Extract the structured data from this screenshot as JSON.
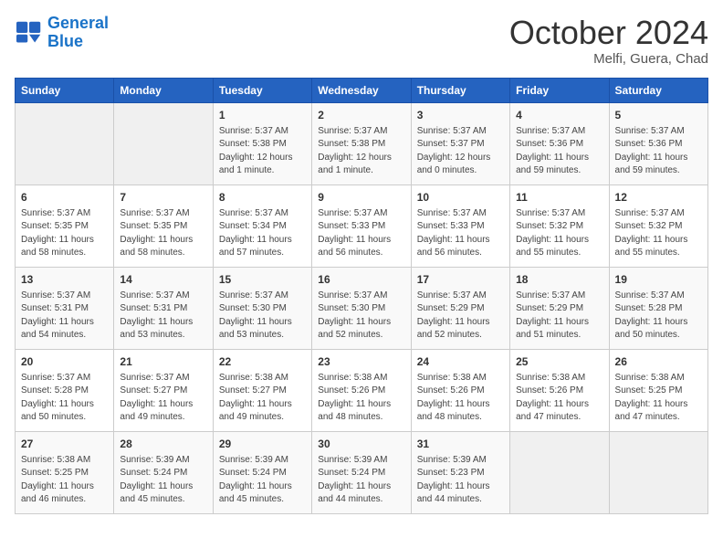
{
  "header": {
    "logo_line1": "General",
    "logo_line2": "Blue",
    "month": "October 2024",
    "location": "Melfi, Guera, Chad"
  },
  "weekdays": [
    "Sunday",
    "Monday",
    "Tuesday",
    "Wednesday",
    "Thursday",
    "Friday",
    "Saturday"
  ],
  "weeks": [
    [
      {
        "day": "",
        "info": ""
      },
      {
        "day": "",
        "info": ""
      },
      {
        "day": "1",
        "info": "Sunrise: 5:37 AM\nSunset: 5:38 PM\nDaylight: 12 hours and 1 minute."
      },
      {
        "day": "2",
        "info": "Sunrise: 5:37 AM\nSunset: 5:38 PM\nDaylight: 12 hours and 1 minute."
      },
      {
        "day": "3",
        "info": "Sunrise: 5:37 AM\nSunset: 5:37 PM\nDaylight: 12 hours and 0 minutes."
      },
      {
        "day": "4",
        "info": "Sunrise: 5:37 AM\nSunset: 5:36 PM\nDaylight: 11 hours and 59 minutes."
      },
      {
        "day": "5",
        "info": "Sunrise: 5:37 AM\nSunset: 5:36 PM\nDaylight: 11 hours and 59 minutes."
      }
    ],
    [
      {
        "day": "6",
        "info": "Sunrise: 5:37 AM\nSunset: 5:35 PM\nDaylight: 11 hours and 58 minutes."
      },
      {
        "day": "7",
        "info": "Sunrise: 5:37 AM\nSunset: 5:35 PM\nDaylight: 11 hours and 58 minutes."
      },
      {
        "day": "8",
        "info": "Sunrise: 5:37 AM\nSunset: 5:34 PM\nDaylight: 11 hours and 57 minutes."
      },
      {
        "day": "9",
        "info": "Sunrise: 5:37 AM\nSunset: 5:33 PM\nDaylight: 11 hours and 56 minutes."
      },
      {
        "day": "10",
        "info": "Sunrise: 5:37 AM\nSunset: 5:33 PM\nDaylight: 11 hours and 56 minutes."
      },
      {
        "day": "11",
        "info": "Sunrise: 5:37 AM\nSunset: 5:32 PM\nDaylight: 11 hours and 55 minutes."
      },
      {
        "day": "12",
        "info": "Sunrise: 5:37 AM\nSunset: 5:32 PM\nDaylight: 11 hours and 55 minutes."
      }
    ],
    [
      {
        "day": "13",
        "info": "Sunrise: 5:37 AM\nSunset: 5:31 PM\nDaylight: 11 hours and 54 minutes."
      },
      {
        "day": "14",
        "info": "Sunrise: 5:37 AM\nSunset: 5:31 PM\nDaylight: 11 hours and 53 minutes."
      },
      {
        "day": "15",
        "info": "Sunrise: 5:37 AM\nSunset: 5:30 PM\nDaylight: 11 hours and 53 minutes."
      },
      {
        "day": "16",
        "info": "Sunrise: 5:37 AM\nSunset: 5:30 PM\nDaylight: 11 hours and 52 minutes."
      },
      {
        "day": "17",
        "info": "Sunrise: 5:37 AM\nSunset: 5:29 PM\nDaylight: 11 hours and 52 minutes."
      },
      {
        "day": "18",
        "info": "Sunrise: 5:37 AM\nSunset: 5:29 PM\nDaylight: 11 hours and 51 minutes."
      },
      {
        "day": "19",
        "info": "Sunrise: 5:37 AM\nSunset: 5:28 PM\nDaylight: 11 hours and 50 minutes."
      }
    ],
    [
      {
        "day": "20",
        "info": "Sunrise: 5:37 AM\nSunset: 5:28 PM\nDaylight: 11 hours and 50 minutes."
      },
      {
        "day": "21",
        "info": "Sunrise: 5:37 AM\nSunset: 5:27 PM\nDaylight: 11 hours and 49 minutes."
      },
      {
        "day": "22",
        "info": "Sunrise: 5:38 AM\nSunset: 5:27 PM\nDaylight: 11 hours and 49 minutes."
      },
      {
        "day": "23",
        "info": "Sunrise: 5:38 AM\nSunset: 5:26 PM\nDaylight: 11 hours and 48 minutes."
      },
      {
        "day": "24",
        "info": "Sunrise: 5:38 AM\nSunset: 5:26 PM\nDaylight: 11 hours and 48 minutes."
      },
      {
        "day": "25",
        "info": "Sunrise: 5:38 AM\nSunset: 5:26 PM\nDaylight: 11 hours and 47 minutes."
      },
      {
        "day": "26",
        "info": "Sunrise: 5:38 AM\nSunset: 5:25 PM\nDaylight: 11 hours and 47 minutes."
      }
    ],
    [
      {
        "day": "27",
        "info": "Sunrise: 5:38 AM\nSunset: 5:25 PM\nDaylight: 11 hours and 46 minutes."
      },
      {
        "day": "28",
        "info": "Sunrise: 5:39 AM\nSunset: 5:24 PM\nDaylight: 11 hours and 45 minutes."
      },
      {
        "day": "29",
        "info": "Sunrise: 5:39 AM\nSunset: 5:24 PM\nDaylight: 11 hours and 45 minutes."
      },
      {
        "day": "30",
        "info": "Sunrise: 5:39 AM\nSunset: 5:24 PM\nDaylight: 11 hours and 44 minutes."
      },
      {
        "day": "31",
        "info": "Sunrise: 5:39 AM\nSunset: 5:23 PM\nDaylight: 11 hours and 44 minutes."
      },
      {
        "day": "",
        "info": ""
      },
      {
        "day": "",
        "info": ""
      }
    ]
  ]
}
